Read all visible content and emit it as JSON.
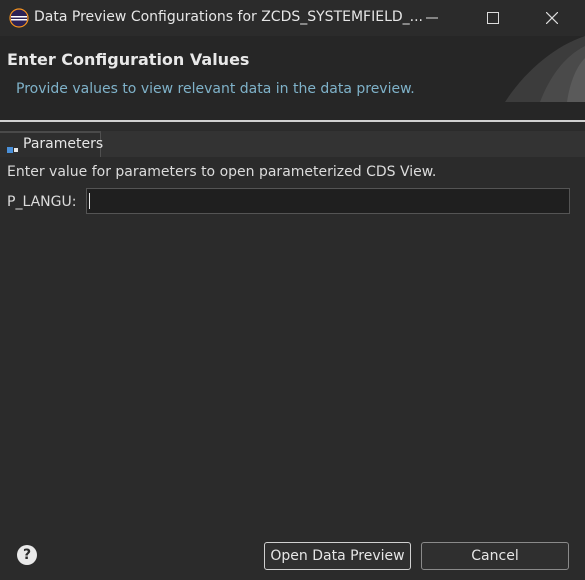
{
  "window": {
    "title": "Data Preview Configurations for ZCDS_SYSTEMFIELD_..."
  },
  "header": {
    "title": "Enter Configuration Values",
    "description": "Provide values to view relevant data in the data preview."
  },
  "tabs": [
    {
      "label": "Parameters",
      "active": true
    }
  ],
  "content": {
    "instruction": "Enter value for parameters to open parameterized CDS View.",
    "parameters": [
      {
        "label": "P_LANGU:",
        "value": ""
      }
    ]
  },
  "footer": {
    "help_symbol": "?",
    "open_label": "Open Data Preview",
    "cancel_label": "Cancel"
  },
  "colors": {
    "background": "#2b2b2b",
    "header_text_accent": "#7fb2c9"
  },
  "icons": {
    "app": "eclipse-icon",
    "tab": "parameters-icon",
    "help": "help-icon",
    "minimize": "minimize-icon",
    "maximize": "maximize-icon",
    "close": "close-icon"
  }
}
